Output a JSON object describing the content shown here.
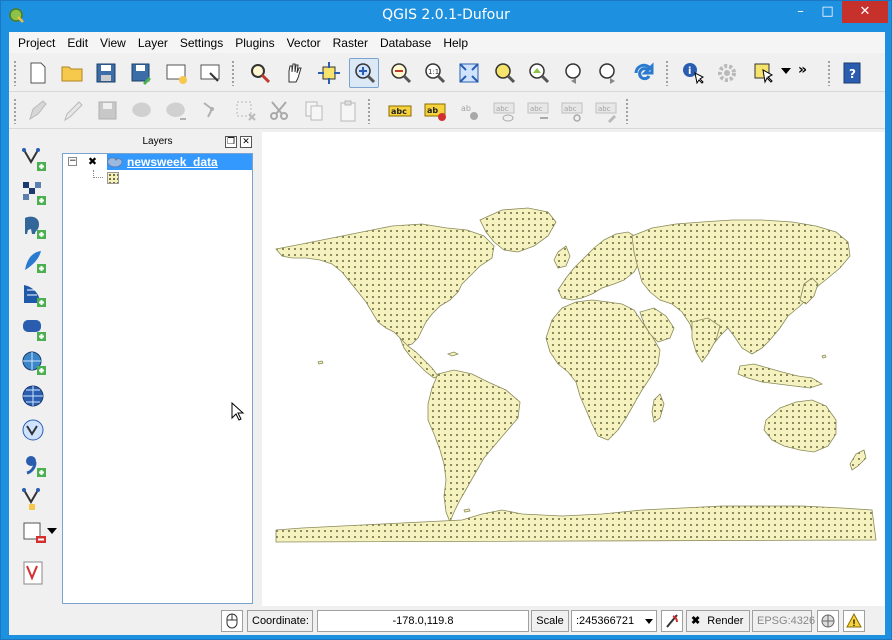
{
  "window": {
    "title": "QGIS 2.0.1-Dufour",
    "min": "–",
    "max": "□",
    "close": "✕"
  },
  "menu": [
    "Project",
    "Edit",
    "View",
    "Layer",
    "Settings",
    "Plugins",
    "Vector",
    "Raster",
    "Database",
    "Help"
  ],
  "toolbar_more": "»",
  "layers_panel": {
    "title": "Layers",
    "float_btn": "❐",
    "close_btn": "✕",
    "layer": {
      "name": "newsweek_data",
      "expander": "−",
      "visible_mark": "✖"
    }
  },
  "status": {
    "coordinate_label": "Coordinate:",
    "coordinate_value": "-178.0,119.8",
    "scale_label": "Scale",
    "scale_value": ":245366721",
    "render_mark": "✖",
    "render_label": "Render",
    "crs": "EPSG:4326",
    "warning": "!"
  },
  "colors": {
    "titlebar": "#1e90e0",
    "land_fill": "#f5f2c0",
    "land_dots": "#6a6a3a",
    "selection": "#3399ff"
  }
}
